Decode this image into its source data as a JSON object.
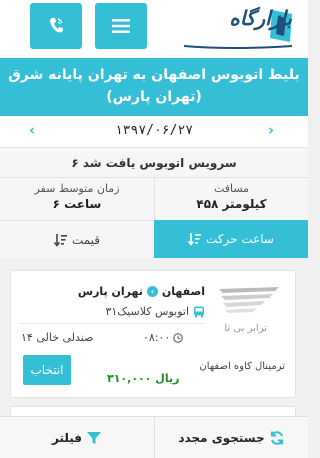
{
  "header": {
    "logo_text": "بازارگاه",
    "phone_icon": "phone-icon",
    "menu_icon": "hamburger-menu-icon"
  },
  "page_title": "بلیط اتوبوس اصفهان به تهران پایانه شرق (تهران پارس)",
  "date_nav": {
    "date": "۱۳۹۷/۰۶/۲۷",
    "prev_icon": "chevron-left-icon",
    "next_icon": "chevron-right-icon"
  },
  "summary": {
    "found_text": "۶ سرویس اتوبوس یافت شد",
    "distance_label": "مسافت",
    "distance_value": "۴۵۸ کیلومتر",
    "avg_time_label": "زمان متوسط سفر",
    "avg_time_value": "۶ ساعت"
  },
  "sort": {
    "departure_label": "ساعت حرکت",
    "price_label": "قیمت"
  },
  "result": {
    "origin": "اصفهان",
    "destination": "تهران پارس",
    "bus_type": "اتوبوس کلاسیک۳۱",
    "departure_time": "۰۸:۰۰",
    "seats": "۱۴ صندلی خالی",
    "select_label": "انتخاب",
    "price": "۳۱۰,۰۰۰ ریال",
    "company": "ترابر بی تا",
    "terminal": "ترمینال کاوه اصفهان"
  },
  "bottom": {
    "search_label": "جستجوی مجدد",
    "filter_label": "فیلتر"
  },
  "colors": {
    "accent": "#35bfd6",
    "price": "#1f8c1f"
  }
}
